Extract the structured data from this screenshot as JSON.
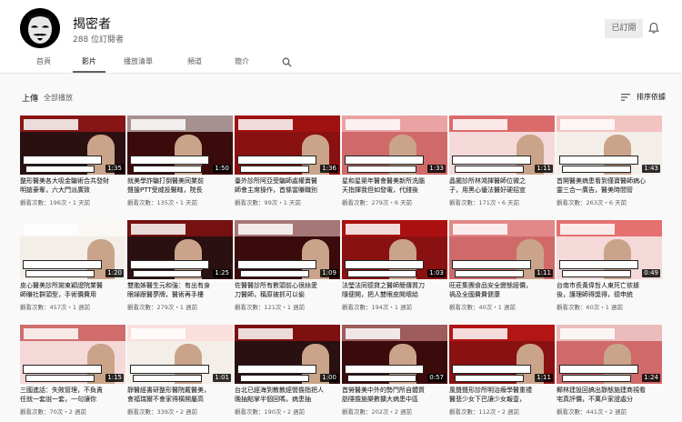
{
  "channel": {
    "name": "揭密者",
    "subscribers": "288 位訂閱者",
    "subscribed_label": "已訂閱"
  },
  "tabs": [
    "首頁",
    "影片",
    "播放清單",
    "頻道",
    "簡介"
  ],
  "section": {
    "title": "上傳",
    "play_all": "全部播放",
    "sort_label": "排序依據"
  },
  "videos": [
    {
      "duration": "1:35",
      "title1": "整形醫美各大吸金騙術合共發財",
      "title2": "明搶豪奪，六大門派廣致",
      "meta": "觀看次數：196次・1 天前"
    },
    {
      "duration": "1:50",
      "title1": "就美學詐騙打倒醫美同業前",
      "title2": "聲援PTT受威投醫瞎，院長",
      "meta": "觀看次數：135次・1 天前"
    },
    {
      "duration": "1:36",
      "title1": "臺外診所阿亞受騙師處權賣醫",
      "title2": "師會主席操作，首條當賺職別",
      "meta": "觀看次數：99次・1 天前"
    },
    {
      "duration": "1:33",
      "title1": "星和星渠年醫會醫美新所洗腦",
      "title2": "天指揮我但如發電，代錢後",
      "meta": "觀看次數：279次・6 天前"
    },
    {
      "duration": "1:11",
      "title1": "晶擺診所林鴻揮醫師位微之",
      "title2": "子，用黑心優法醫好硬招宣",
      "meta": "觀看次數：171次・6 天前"
    },
    {
      "duration": "1:43",
      "title1": "首開醫美病患看到僅寶醫師病心",
      "title2": "靈三合一廣告，醫美時間管",
      "meta": "觀看次數：263次・6 天前"
    },
    {
      "duration": "1:20",
      "title1": "皮心醫美診所謝東穎證院業醫",
      "title2": "師賺社群頭型，手術價費用",
      "meta": "觀看次數：457次・1 週前"
    },
    {
      "duration": "1:25",
      "title1": "雙胞姊醫生元和強：有出有身",
      "title2": "眼婦跟醫夢牌，醫術再手樓",
      "meta": "觀看次數：279次・1 週前"
    },
    {
      "duration": "1:09",
      "title1": "佐醫醫診所有數頭前心很絲愛",
      "title2": "刀醫師，稱原被抓可以偷",
      "meta": "觀看次數：121次・1 週前"
    },
    {
      "duration": "1:03",
      "title1": "法瑩法同德貸之醫師簡傳質刀",
      "title2": "隨便開，把人雙眼皮開壞給",
      "meta": "觀看次數：194次・1 週前"
    },
    {
      "duration": "1:11",
      "title1": "旺莊集團食品安全變態經價，",
      "title2": "禍及全國費費健康",
      "meta": "觀看次數：40次・1 週前"
    },
    {
      "duration": "0:49",
      "title1": "台南市長黃偉哲人東死亡依據",
      "title2": "後，護理師得獎得，德申統",
      "meta": "觀看次數：60次・1 週前"
    },
    {
      "duration": "1:15",
      "title1": "三國進話：失敗管理，不負責",
      "title2": "任就一套說一套，一句讓你",
      "meta": "觀看次數：70次・2 週前"
    },
    {
      "duration": "1:01",
      "title1": "靜醫經書研整形醫院戴醫美，",
      "title2": "會福瑞爾不會家得橫開屬高",
      "meta": "觀看次數：339次・2 週前"
    },
    {
      "duration": "1:00",
      "title1": "台北已經海到教教經營擔指把人",
      "title2": "晚抽點掌半個回嗎，病患抽",
      "meta": "觀看次數：190次・2 週前"
    },
    {
      "duration": "0:57",
      "title1": "首勞醫美中外的勢鬥所自體質",
      "title2": "肪隱擔施樂數擴大病患中區",
      "meta": "觀看次數：202次・2 週前"
    },
    {
      "duration": "1:11",
      "title1": "風聲聲形診所明治療學醫重禮",
      "title2": "醫悲少女下巴讓少女報壹，",
      "meta": "觀看次數：112次・2 週前"
    },
    {
      "duration": "1:24",
      "title1": "椰林建設回搞出靜態施建商視看",
      "title2": "宅真評價，不萬戶家證處分",
      "meta": "觀看次數：441次・2 週前"
    }
  ],
  "colors": {
    "accent_red": "#cc0000",
    "meta_gray": "#606060",
    "thumb_themes": [
      "#2a1010",
      "#f3efe8",
      "#f5d9d9",
      "#d06a6a",
      "#8a1111",
      "#3b0b0b"
    ]
  },
  "icons": {
    "bell": "bell-icon",
    "search": "search-icon",
    "sort": "sort-icon",
    "avatar": "anonymous-mask"
  }
}
